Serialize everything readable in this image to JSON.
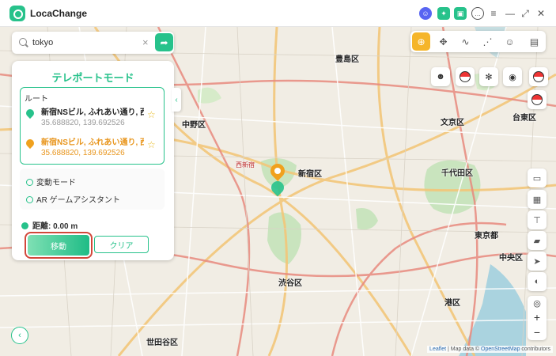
{
  "app": {
    "title": "LocaChange"
  },
  "titlebar": {
    "icons": [
      "discord-icon",
      "gift-icon",
      "shop-icon",
      "chat-icon",
      "menu-icon",
      "minimize-icon",
      "maximize-icon",
      "close-icon"
    ]
  },
  "search": {
    "value": "tokyo",
    "placeholder": ""
  },
  "panel": {
    "title": "テレポートモード",
    "route_label": "ルート",
    "start": {
      "name": "新宿NSビル, ふれあい通り, 西新...",
      "coords": "35.688820, 139.692526"
    },
    "end": {
      "name": "新宿NSビル, ふれあい通り, 西新...",
      "coords": "35.688820, 139.692526"
    },
    "modes": [
      "変動モード",
      "AR ゲームアシスタント"
    ],
    "distance": "距離: 0.00 m",
    "move_label": "移動",
    "clear_label": "クリア"
  },
  "map": {
    "labels": {
      "toshima": "豊島区",
      "nakano": "中野区",
      "shinjuku": "新宿区",
      "bunkyo": "文京区",
      "chiyoda": "千代田区",
      "tokyo_to": "東京都",
      "chuo": "中央区",
      "shibuya": "渋谷区",
      "minato": "港区",
      "setagaya": "世田谷区",
      "taito": "台東区",
      "nishi_shinjuku": "西新宿"
    },
    "attribution": {
      "leaflet": "Leaflet",
      "text": "| Map data ©",
      "osm": "OpenStreetMap",
      "contrib": "contributors"
    }
  },
  "colors": {
    "accent": "#27c28b",
    "orange": "#f0a11e",
    "highlight": "#d2473a"
  }
}
